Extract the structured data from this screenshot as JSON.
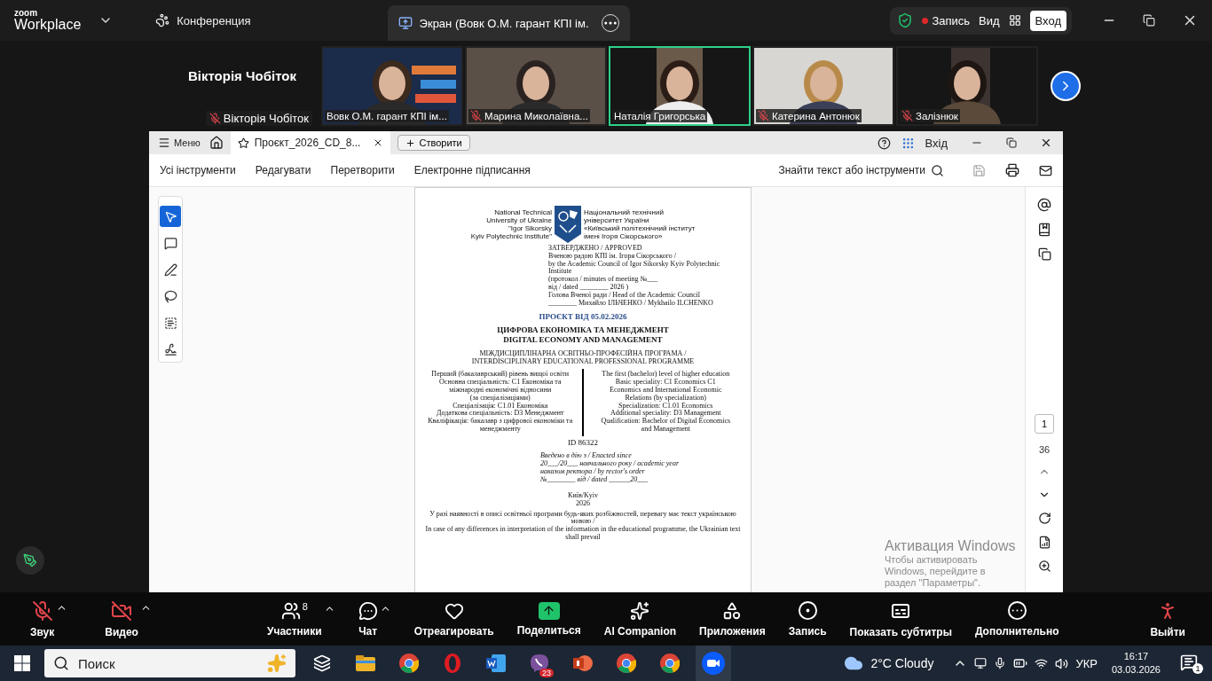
{
  "zoom_bar": {
    "logo_top": "zoom",
    "logo_bottom": "Workplace",
    "meeting_tab": "Конференция",
    "screen_tab": "Экран (Вовк О.М. гарант КПІ ім.",
    "record_label": "Запись",
    "view_label": "Вид",
    "signin_button": "Вход"
  },
  "speaker": {
    "name": "Вікторія Чобіток",
    "label": "Вікторія Чобіток",
    "muted": true
  },
  "participants": [
    {
      "name": "Вовк О.М. гарант КПІ ім...",
      "muted": false,
      "selected": false
    },
    {
      "name": "Марина Миколаївна...",
      "muted": true,
      "selected": false
    },
    {
      "name": "Наталія Григорська",
      "muted": false,
      "selected": true
    },
    {
      "name": "Катерина Антонюк",
      "muted": true,
      "selected": false
    },
    {
      "name": "Залізнюк",
      "muted": true,
      "selected": false
    }
  ],
  "viewer": {
    "menu": "Меню",
    "tab": "Проєкт_2026_CD_8...",
    "create_button": "Створити",
    "signin": "Вхід",
    "toolbar": [
      "Усі інструменти",
      "Редагувати",
      "Перетворити",
      "Електронне підписання"
    ],
    "search": "Знайти текст або інструменти",
    "tools": [
      {
        "kind": "select",
        "selected": true
      },
      {
        "kind": "comment",
        "selected": false
      },
      {
        "kind": "draw",
        "selected": false
      },
      {
        "kind": "lasso",
        "selected": false
      },
      {
        "kind": "text",
        "selected": false
      },
      {
        "kind": "sign",
        "selected": false
      }
    ],
    "page_number": "1",
    "page_total": "36"
  },
  "document": {
    "logo_left": [
      "National Technical",
      "University of Ukraine",
      "\"Igor Sikorsky",
      "Kyiv Polytechnic Institute\""
    ],
    "logo_right": [
      "Національний технічний",
      "університет України",
      "«Київський політехнічний інститут",
      "імені Ігоря Сікорського»"
    ],
    "approval": [
      "ЗАТВЕРДЖЕНО / APPROVED",
      "Вченою радою КПІ ім. Ігоря Сікорського /",
      "by the Academic Council of Igor Sikorsky Kyiv Polytechnic",
      "Institute",
      "(протокол / minutes of meeting №___",
      "від / dated ________ 2026 )",
      "Голова Вченої ради / Head of the Academic Council",
      "________ Михайло ІЛЬЧЕНКО / Mykhailo ILCHENKO"
    ],
    "draft_mark": "ПРОЄКТ ВІД 05.02.2026",
    "title": [
      "ЦИФРОВА ЕКОНОМІКА ТА МЕНЕДЖМЕНТ",
      "DIGITAL ECONOMY AND MANAGEMENT"
    ],
    "subtitle": [
      "МІЖДИСЦИПЛІНАРНА ОСВІТНЬО-ПРОФЕСІЙНА ПРОГРАМА /",
      "INTERDISCIPLINARY EDUCATIONAL PROFESSIONAL PROGRAMME"
    ],
    "left_column": [
      "Перший (бакалаврський) рівень вищої освіти",
      "Основна спеціальність: С1 Економіка та",
      "міжнародні економічні відносини",
      "(за спеціалізаціями)",
      "Спеціалізація: С1.01 Економіка",
      "Додаткова спеціальність: D3 Менеджмент",
      "Кваліфікація: бакалавр з цифрової економіки та",
      "менеджменту"
    ],
    "right_column": [
      "The first (bachelor) level of higher education",
      "Basic speciality: C1 Economics C1",
      "Economics and International Economic",
      "Relations (by specialization)",
      "Specialization: C1.01 Economics",
      "Additional speciality: D3 Management",
      "Qualification: Bachelor of Digital Economics",
      "and Management"
    ],
    "id": "ID 86322",
    "enacted": [
      "Введено в дію з / Enacted since",
      "20___/20___ навчального року / academic year",
      "наказом ректора / by rector's order",
      "№________ від / dated ______20___"
    ],
    "city": "Київ/Kyiv",
    "year": "2026",
    "footnote": [
      "У разі наявності в описі освітньої програми будь-яких розбіжностей, перевагу має текст українською мовою /",
      "In case of any differences in interpretation of the information in the educational programme, the Ukrainian text shall prevail"
    ]
  },
  "activation_notice": {
    "title": "Активация Windows",
    "text": "Чтобы активировать Windows, перейдите в раздел \"Параметры\"."
  },
  "controls": [
    {
      "kind": "mic",
      "label": "Звук",
      "off": true,
      "caret": true
    },
    {
      "kind": "video",
      "label": "Видео",
      "off": true,
      "caret": true
    },
    {
      "kind": "participants",
      "label": "Участники",
      "count": "8",
      "caret": true
    },
    {
      "kind": "chat",
      "label": "Чат",
      "caret": true
    },
    {
      "kind": "react",
      "label": "Отреагировать",
      "caret": false
    },
    {
      "kind": "share",
      "label": "Поделиться",
      "caret": false
    },
    {
      "kind": "ai",
      "label": "AI Companion",
      "caret": false
    },
    {
      "kind": "apps",
      "label": "Приложения",
      "caret": false
    },
    {
      "kind": "record",
      "label": "Запись",
      "caret": false
    },
    {
      "kind": "captions",
      "label": "Показать субтитры",
      "caret": false
    },
    {
      "kind": "more",
      "label": "Дополнительно",
      "caret": false
    },
    {
      "kind": "leave",
      "label": "Выйти",
      "caret": false
    }
  ],
  "taskbar": {
    "search": "Поиск",
    "apps": [
      {
        "kind": "taskview",
        "active": false
      },
      {
        "kind": "folder",
        "active": false
      },
      {
        "kind": "browser",
        "active": false
      },
      {
        "kind": "ring",
        "active": false
      },
      {
        "kind": "word",
        "active": false
      },
      {
        "kind": "chat",
        "active": false,
        "badge": "23"
      },
      {
        "kind": "slides",
        "active": false
      },
      {
        "kind": "browser",
        "active": false
      },
      {
        "kind": "browser",
        "active": false
      },
      {
        "kind": "zoom",
        "active": true
      }
    ],
    "weather": "2°C Cloudy",
    "language": "УКР",
    "time": "16:17",
    "date": "03.03.2026",
    "notifications": "1"
  }
}
